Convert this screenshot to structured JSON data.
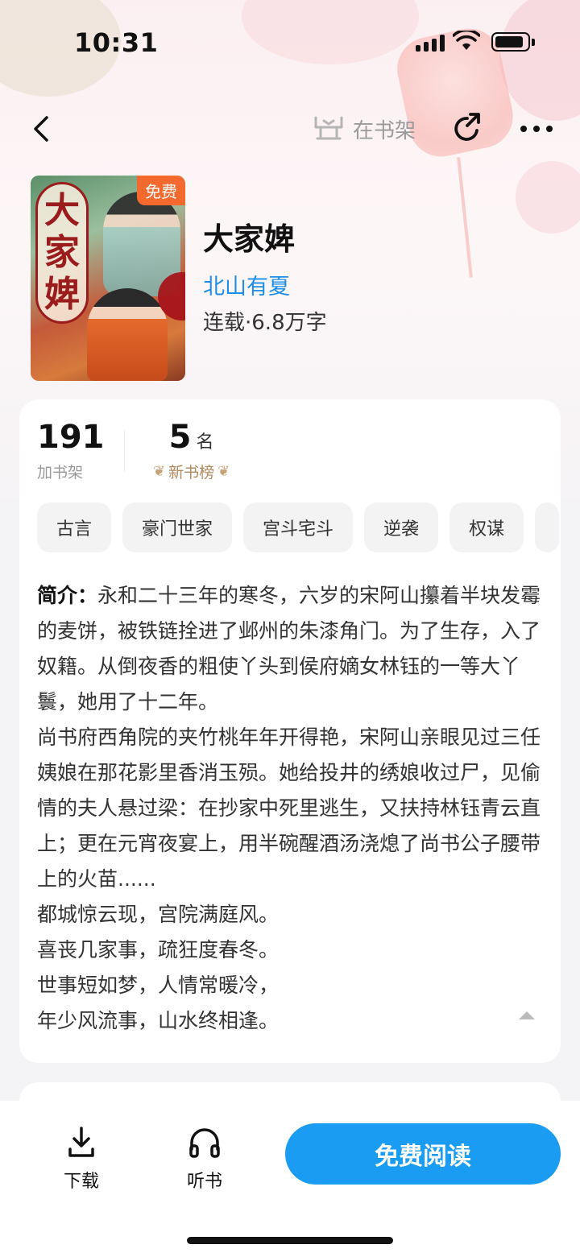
{
  "status_bar": {
    "time": "10:31"
  },
  "nav": {
    "shelf_label": "在书架",
    "back_icon": "chevron-left-icon",
    "share_icon": "share-icon",
    "more_icon": "more-dots-icon"
  },
  "book": {
    "cover_title": "大家婢",
    "free_badge": "免费",
    "title": "大家婢",
    "author": "北山有夏",
    "meta": "连载·6.8万字"
  },
  "stats": {
    "shelf_count": "191",
    "shelf_label": "加书架",
    "rank": "5",
    "rank_unit": "名",
    "rank_label": "新书榜"
  },
  "tags": [
    "古言",
    "豪门世家",
    "宫斗宅斗",
    "逆袭",
    "权谋"
  ],
  "synopsis": {
    "label": "简介：",
    "first": "永和二十三年的寒冬，六岁的宋阿山攥着半块发霉的麦饼，被铁链拴进了邺州的朱漆角门。为了生存，入了奴籍。从倒夜香的粗使丫头到侯府嫡女林钰的一等大丫鬟，她用了十二年。",
    "p2": "尚书府西角院的夹竹桃年年开得艳，宋阿山亲眼见过三任姨娘在那花影里香消玉殒。她给投井的绣娘收过尸，见偷情的夫人悬过梁：在抄家中死里逃生，又扶持林钰青云直上；更在元宵夜宴上，用半碗醒酒汤浇熄了尚书公子腰带上的火苗......",
    "p3": "都城惊云现，宫院满庭风。",
    "p4": "喜丧几家事，疏狂度春冬。",
    "p5": "世事短如梦，人情常暖冷，",
    "p6": "年少风流事，山水终相逢。"
  },
  "bottom_bar": {
    "download_label": "下载",
    "listen_label": "听书",
    "read_label": "免费阅读"
  },
  "colors": {
    "accent": "#1a9cf3",
    "author": "#1e8ee8",
    "badge": "#f46a2e"
  }
}
